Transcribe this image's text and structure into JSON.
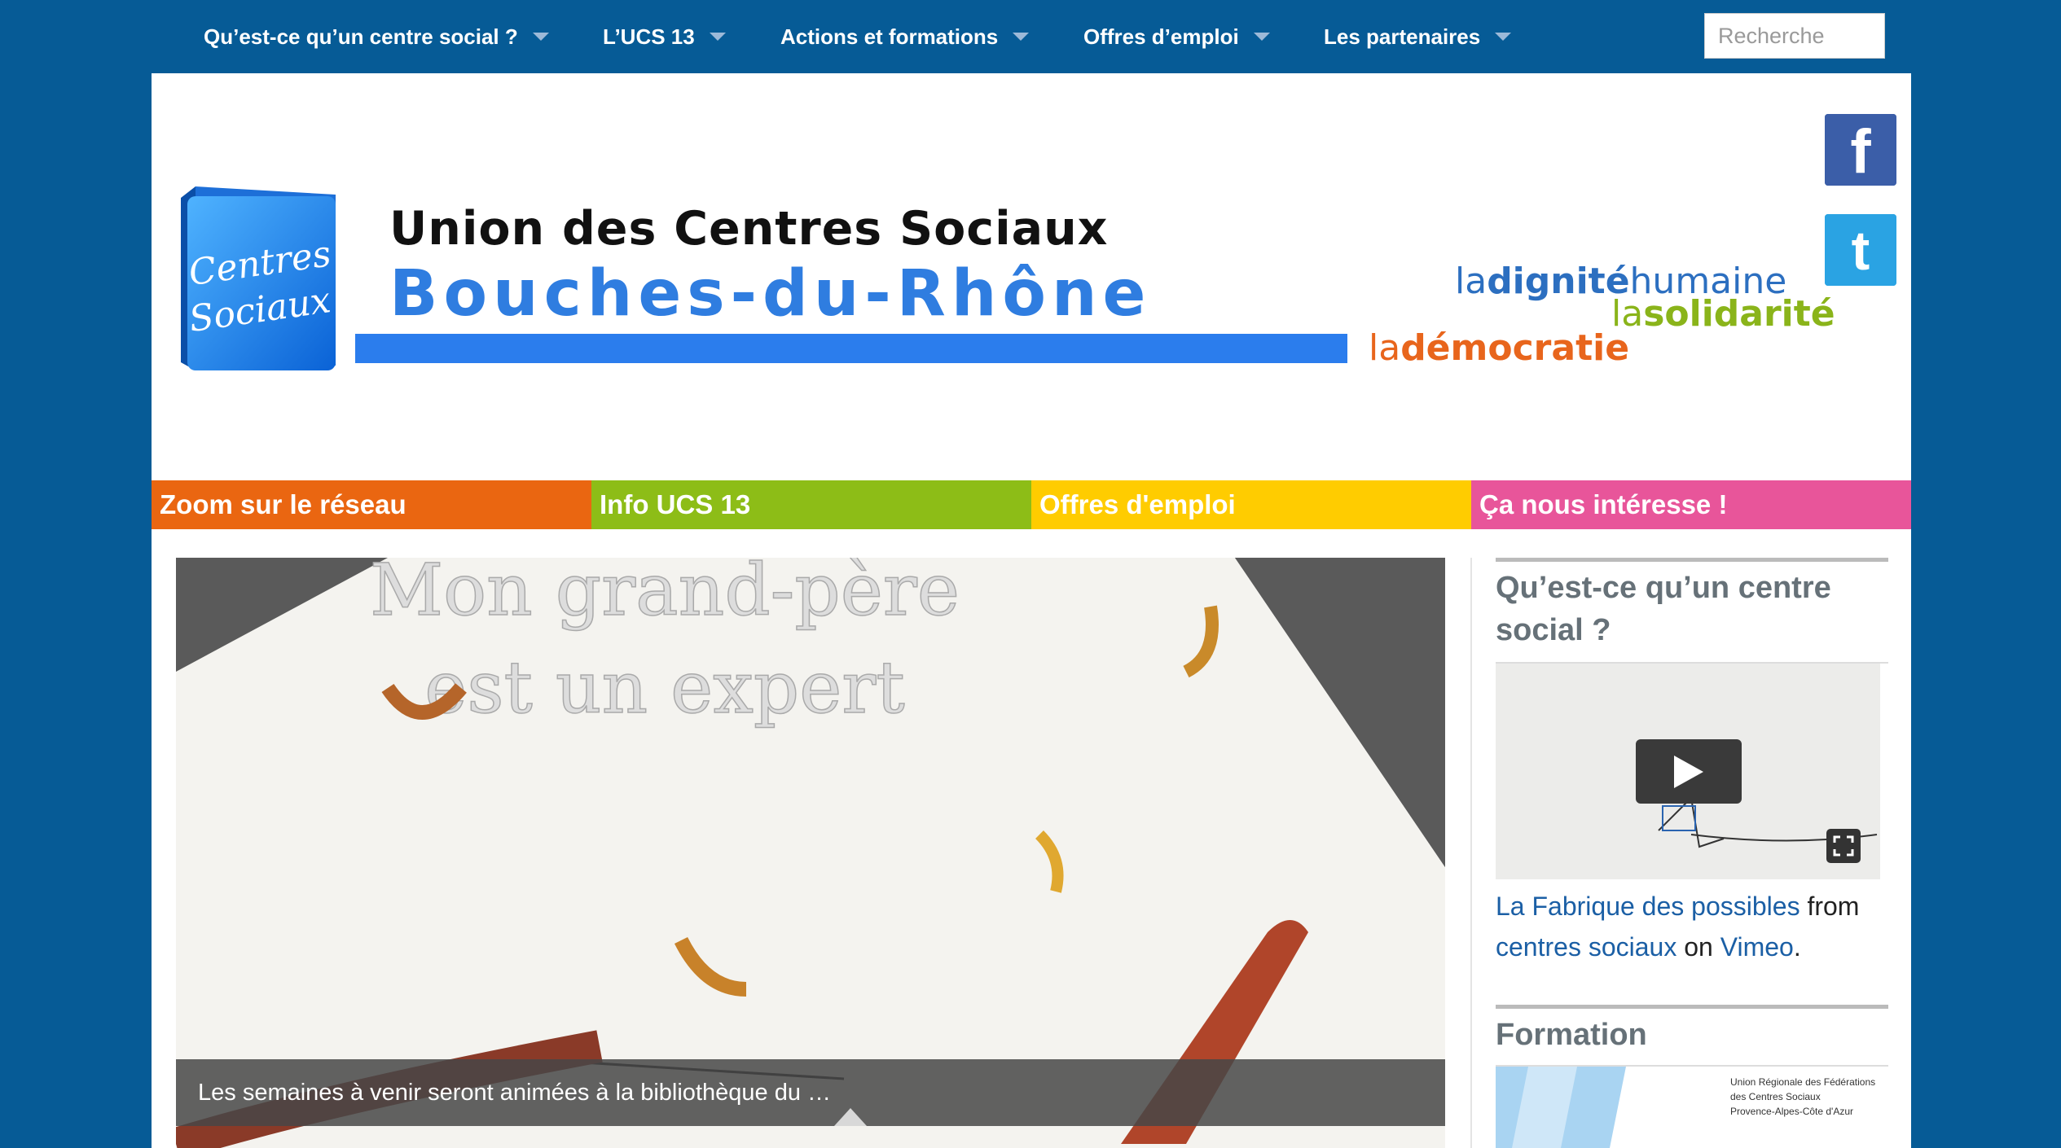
{
  "nav": {
    "items": [
      {
        "label": "Qu’est-ce qu’un centre social ?"
      },
      {
        "label": "L’UCS 13"
      },
      {
        "label": "Actions et formations"
      },
      {
        "label": "Offres d’emploi"
      },
      {
        "label": "Les partenaires"
      }
    ],
    "search_placeholder": "Recherche"
  },
  "header": {
    "logo_text": [
      "Centres",
      "Sociaux"
    ],
    "title_line1": "Union des Centres Sociaux",
    "title_line2": "Bouches-du-Rhône",
    "tagline": {
      "t1_prefix": "la",
      "t1_bold": "dignité",
      "t1_suffix": "humaine",
      "t2_prefix": "la",
      "t2_bold": "solidarité",
      "t3_prefix": "la",
      "t3_bold": "démocratie"
    }
  },
  "social": {
    "facebook_glyph": "f",
    "twitter_glyph": "t"
  },
  "categories": [
    {
      "label": "Zoom sur le réseau",
      "color": "#ea6611"
    },
    {
      "label": "Info UCS 13",
      "color": "#8dbd17"
    },
    {
      "label": "Offres d'emploi",
      "color": "#ffcc00"
    },
    {
      "label": "Ça nous intéresse !",
      "color": "#e8559a"
    }
  ],
  "slider": {
    "art_line1": "Mon grand-père",
    "art_line2": "est un expert",
    "caption": "Les semaines à venir seront animées à la bibliothèque du …"
  },
  "sidebar": {
    "widget1_title": "Qu’est-ce qu’un centre social ?",
    "video": {
      "title_link": "La Fabrique des possibles",
      "from": "from",
      "author_link": "centres sociaux",
      "on": "on",
      "site_link": "Vimeo",
      "end": "."
    },
    "widget2_title": "Formation",
    "formation_org": [
      "Union Régionale des Fédérations",
      "des Centres Sociaux",
      "Provence-Alpes-Côte d'Azur"
    ]
  },
  "colors": {
    "nav_bg": "#065b96",
    "brand_blue": "#2b7ded",
    "link": "#1b5fa5"
  }
}
